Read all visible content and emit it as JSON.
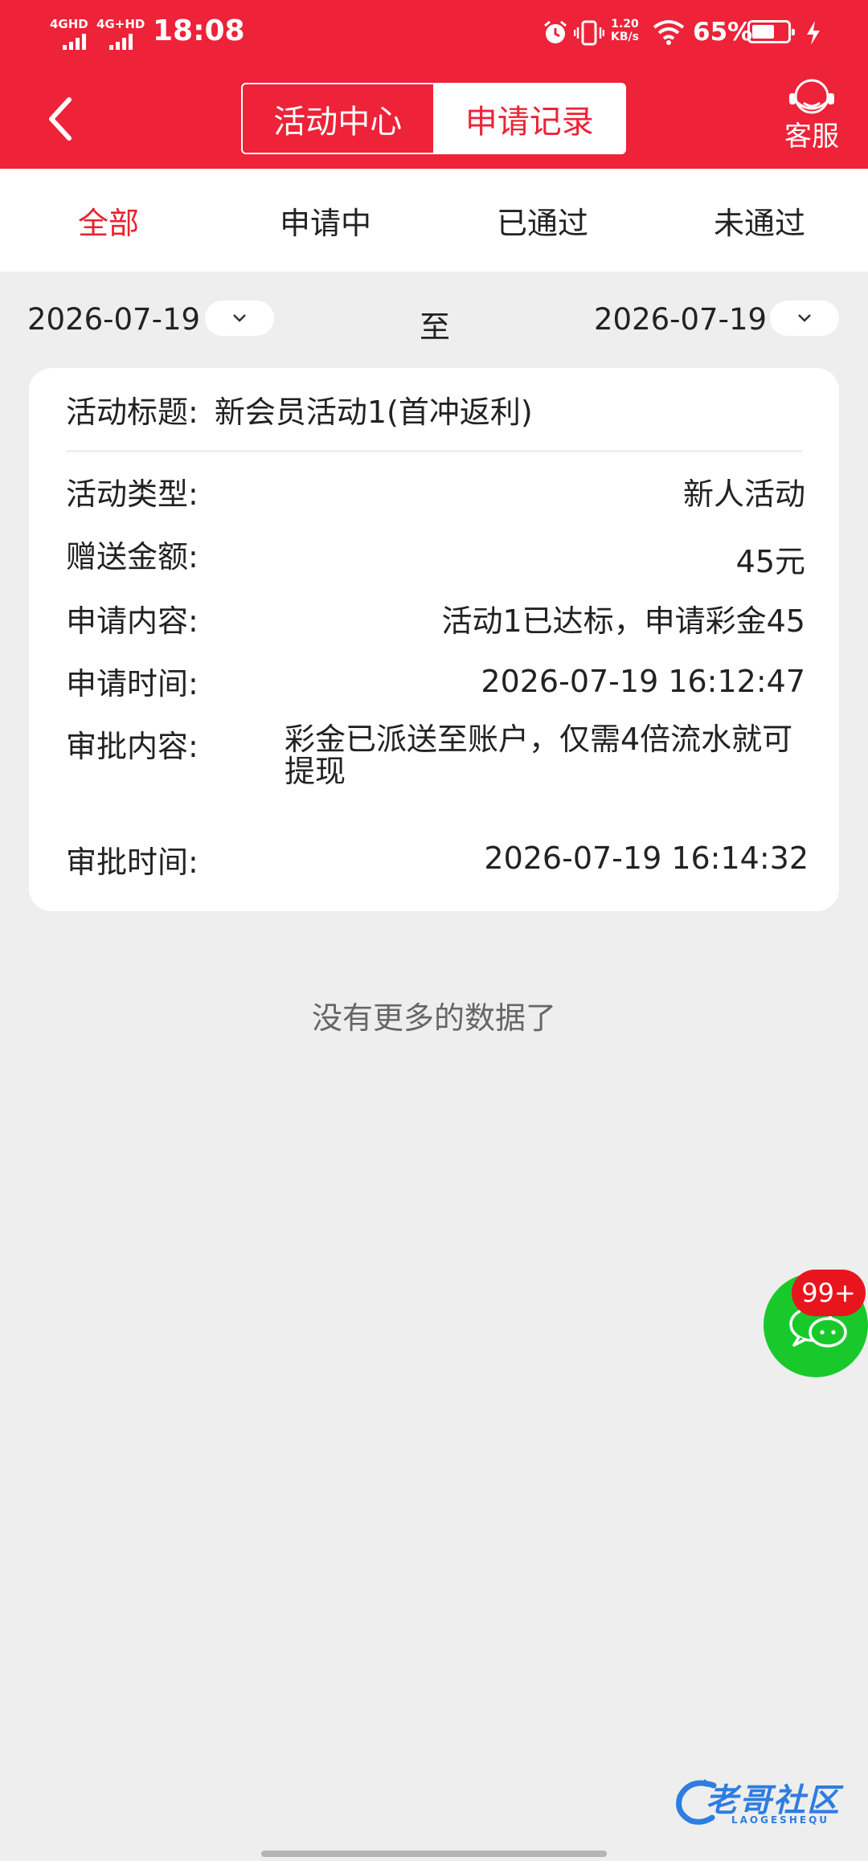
{
  "status_bar": {
    "sim1": "4GHD",
    "sim2": "4G+HD",
    "time": "18:08",
    "speed_value": "1.20",
    "speed_unit": "KB/s",
    "battery_percent": "65%",
    "battery_level": 0.65
  },
  "nav": {
    "segments": [
      "活动中心",
      "申请记录"
    ],
    "active_segment": 1,
    "service_label": "客服"
  },
  "filter_tabs": [
    "全部",
    "申请中",
    "已通过",
    "未通过"
  ],
  "date_range": {
    "start": "2026-07-19",
    "separator": "至",
    "end": "2026-07-19"
  },
  "record": {
    "title_label": "活动标题:",
    "title_value": "新会员活动1(首冲返利)",
    "rows": [
      {
        "label": "活动类型:",
        "value": "新人活动"
      },
      {
        "label": "赠送金额:",
        "value": "45元"
      },
      {
        "label": "申请内容:",
        "value": "活动1已达标，申请彩金45"
      },
      {
        "label": "申请时间:",
        "value": "2026-07-19 16:12:47"
      },
      {
        "label": "审批内容:",
        "value": "彩金已派送至账户，仅需4倍流水就可提现"
      },
      {
        "label": "审批时间:",
        "value": "2026-07-19 16:14:32"
      }
    ]
  },
  "no_more_text": "没有更多的数据了",
  "chat_badge": "99+",
  "watermark": {
    "main": "老哥社区",
    "sub": "LAOGESHEQU"
  },
  "colors": {
    "primary": "#ee2238",
    "chat": "#19c92b",
    "badge": "#e8151d"
  }
}
